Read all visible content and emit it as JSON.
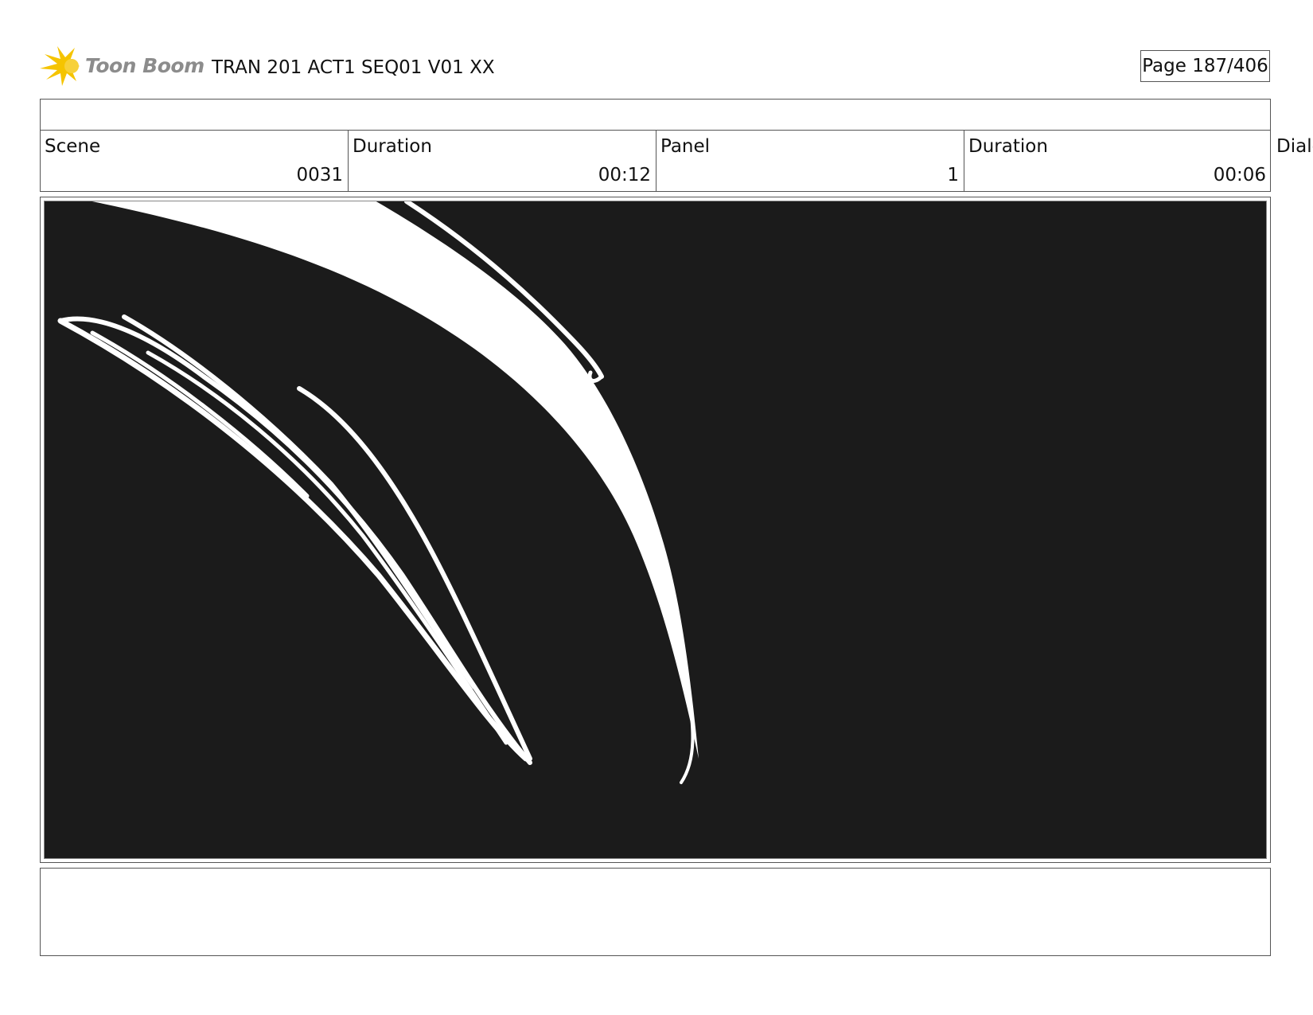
{
  "header": {
    "logo_text": "Toon Boom",
    "title": "TRAN 201 ACT1 SEQ01 V01 XX",
    "page": "Page 187/406"
  },
  "info": {
    "scene_label": "Scene",
    "scene_value": "0031",
    "scene_duration_label": "Duration",
    "scene_duration_value": "00:12",
    "panel_label": "Panel",
    "panel_value": "1",
    "panel_duration_label": "Duration",
    "panel_duration_value": "00:06",
    "dialog_label": "Dialo"
  },
  "colors": {
    "logo_star": "#f5c400",
    "panel_background": "#1b1b1b",
    "strokes": "#ffffff"
  }
}
